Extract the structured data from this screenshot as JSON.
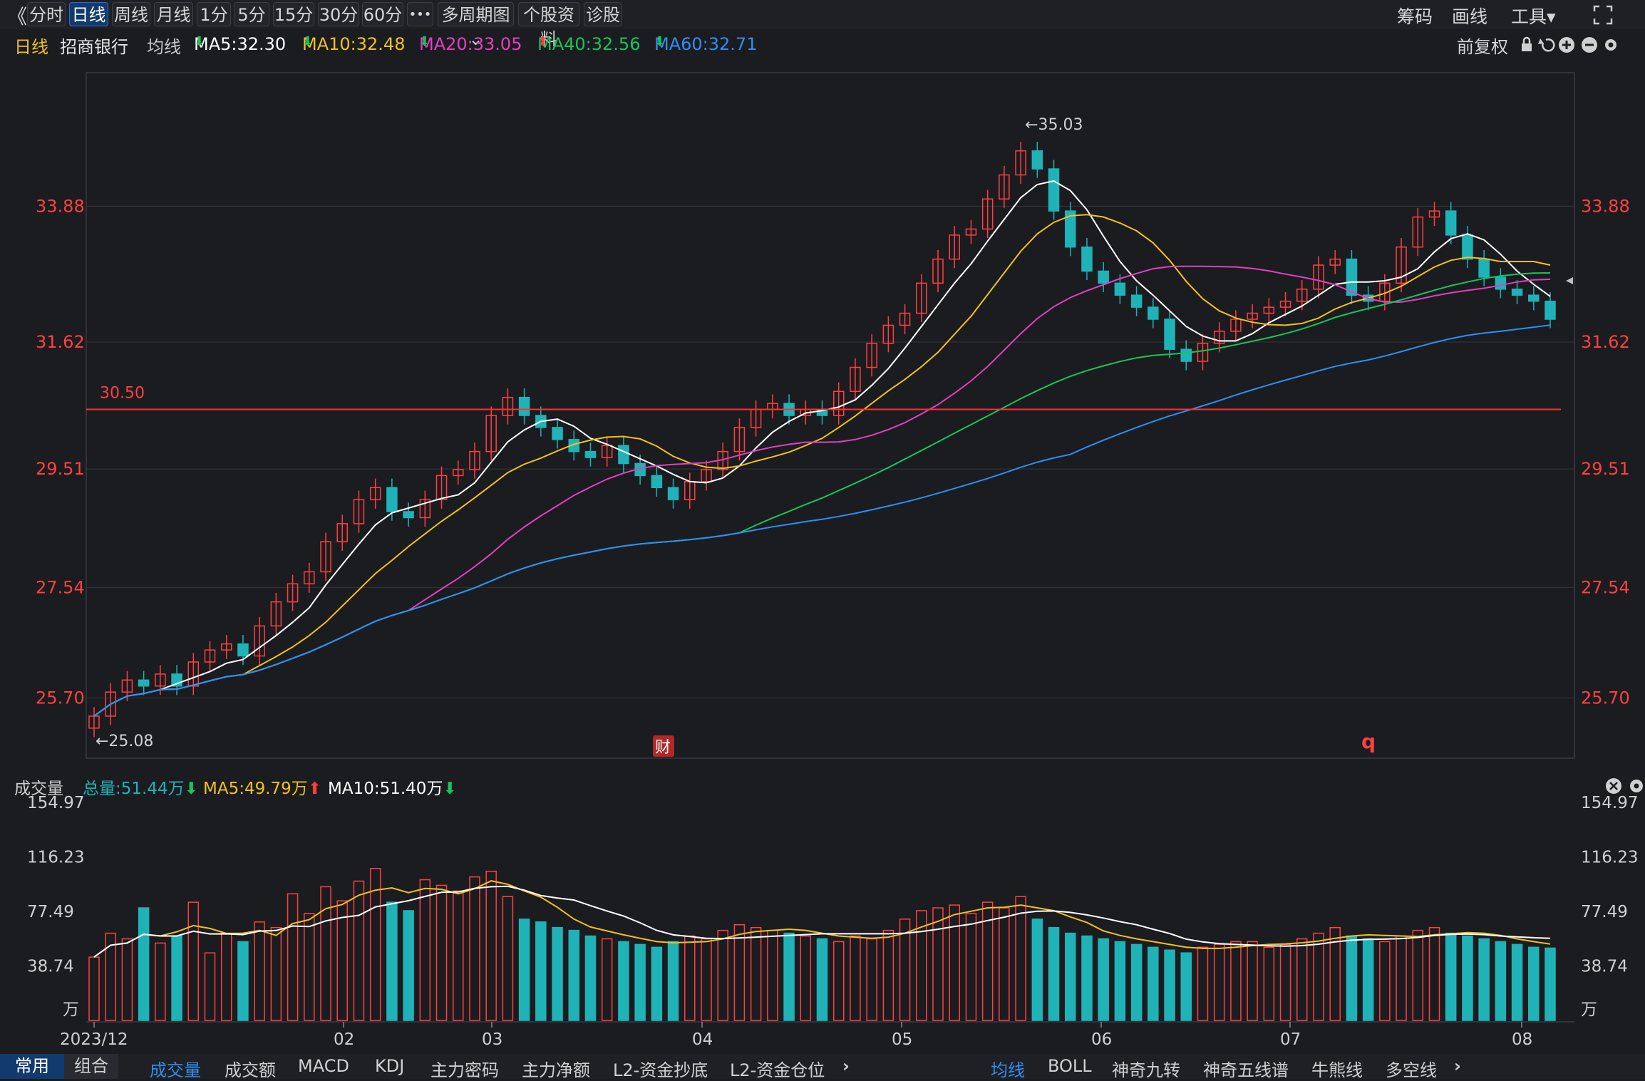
{
  "toolbar": {
    "back": "《",
    "periods": [
      "分时",
      "日线",
      "周线",
      "月线",
      "1分",
      "5分",
      "15分",
      "30分",
      "60分",
      "•••",
      "多周期图 ⌄",
      "个股资料",
      "诊股"
    ],
    "active_period": "日线",
    "right": [
      "筹码",
      "画线",
      "工具▾"
    ],
    "expand_icon": "expand-icon"
  },
  "info": {
    "period": "日线",
    "stock_name": "招商银行",
    "ma_label": "均线",
    "ma": [
      {
        "label": "MA5:32.30",
        "arrow": "⬇",
        "color": "#ffffff",
        "arrow_color": "#19c45a"
      },
      {
        "label": "MA10:32.48",
        "arrow": "⬇",
        "color": "#f0c020",
        "arrow_color": "#19c45a"
      },
      {
        "label": "MA20:33.05",
        "arrow": "⬇",
        "color": "#e040c0",
        "arrow_color": "#19c45a"
      },
      {
        "label": "MA40:32.56",
        "arrow": "⬆",
        "color": "#19c45a",
        "arrow_color": "#ff3b3b"
      },
      {
        "label": "MA60:32.71",
        "arrow": "⬇",
        "color": "#2d8ef5",
        "arrow_color": "#19c45a"
      }
    ],
    "adjust": "前复权"
  },
  "price_axis": {
    "ticks": [
      "33.88",
      "31.62",
      "29.51",
      "27.54",
      "25.70"
    ],
    "min": 24.7,
    "max": 36.1
  },
  "annotations": {
    "high": "←35.03",
    "low": "←25.08",
    "hline_label": "30.50",
    "hline_value": 30.5,
    "fin_badge": "财",
    "q_mark": "q"
  },
  "volume_header": {
    "title": "成交量",
    "total": "总量:51.44万",
    "total_arrow": "⬇",
    "ma5": "MA5:49.79万",
    "ma5_arrow": "⬆",
    "ma10": "MA10:51.40万",
    "ma10_arrow": "⬇"
  },
  "volume_axis": {
    "ticks": [
      "154.97",
      "116.23",
      "77.49",
      "38.74"
    ],
    "unit": "万",
    "max": 154.97
  },
  "time_axis": [
    "2023/12",
    "02",
    "03",
    "04",
    "05",
    "06",
    "07",
    "08"
  ],
  "bottom_tabs": {
    "left": [
      "常用",
      "组合"
    ],
    "indicators": [
      "成交量",
      "成交额",
      "MACD",
      "KDJ",
      "主力密码",
      "主力净额",
      "L2-资金抄底",
      "L2-资金仓位"
    ],
    "right": [
      "均线",
      "BOLL",
      "神奇九转",
      "神奇五线谱",
      "牛熊线",
      "多空线"
    ]
  },
  "colors": {
    "up": "#ff4040",
    "down": "#1fb3b8",
    "ma5": "#ffffff",
    "ma10": "#f0c020",
    "ma20": "#e040c0",
    "ma40": "#19c45a",
    "ma60": "#2d8ef5"
  },
  "chart_data": {
    "type": "candlestick",
    "close_series": [
      25.4,
      25.8,
      26.0,
      25.9,
      26.1,
      25.9,
      26.3,
      26.5,
      26.6,
      26.4,
      26.9,
      27.3,
      27.6,
      27.8,
      28.3,
      28.6,
      29.0,
      29.2,
      28.8,
      28.7,
      29.0,
      29.4,
      29.5,
      29.8,
      30.4,
      30.7,
      30.4,
      30.2,
      30.0,
      29.8,
      29.7,
      29.9,
      29.6,
      29.4,
      29.2,
      29.0,
      29.3,
      29.5,
      29.8,
      30.2,
      30.5,
      30.6,
      30.4,
      30.5,
      30.4,
      30.8,
      31.2,
      31.6,
      31.9,
      32.1,
      32.6,
      33.0,
      33.4,
      33.5,
      34.0,
      34.4,
      34.8,
      34.5,
      33.8,
      33.2,
      32.8,
      32.6,
      32.4,
      32.2,
      32.0,
      31.5,
      31.3,
      31.6,
      31.8,
      32.0,
      32.1,
      32.2,
      32.3,
      32.5,
      32.9,
      33.0,
      32.4,
      32.3,
      32.6,
      33.2,
      33.7,
      33.8,
      33.4,
      33.0,
      32.7,
      32.5,
      32.4,
      32.3,
      32.0
    ],
    "volume_series": [
      45,
      62,
      58,
      80,
      55,
      60,
      84,
      48,
      62,
      56,
      70,
      66,
      90,
      76,
      95,
      85,
      99,
      108,
      84,
      78,
      100,
      96,
      92,
      102,
      106,
      88,
      72,
      70,
      66,
      64,
      60,
      58,
      56,
      54,
      52,
      56,
      60,
      58,
      64,
      68,
      66,
      64,
      62,
      60,
      58,
      56,
      60,
      58,
      64,
      72,
      78,
      80,
      82,
      76,
      84,
      80,
      88,
      72,
      66,
      62,
      60,
      58,
      56,
      54,
      52,
      50,
      48,
      52,
      54,
      56,
      56,
      52,
      54,
      58,
      62,
      66,
      60,
      58,
      56,
      60,
      64,
      66,
      62,
      60,
      58,
      56,
      54,
      52,
      51.44
    ]
  }
}
